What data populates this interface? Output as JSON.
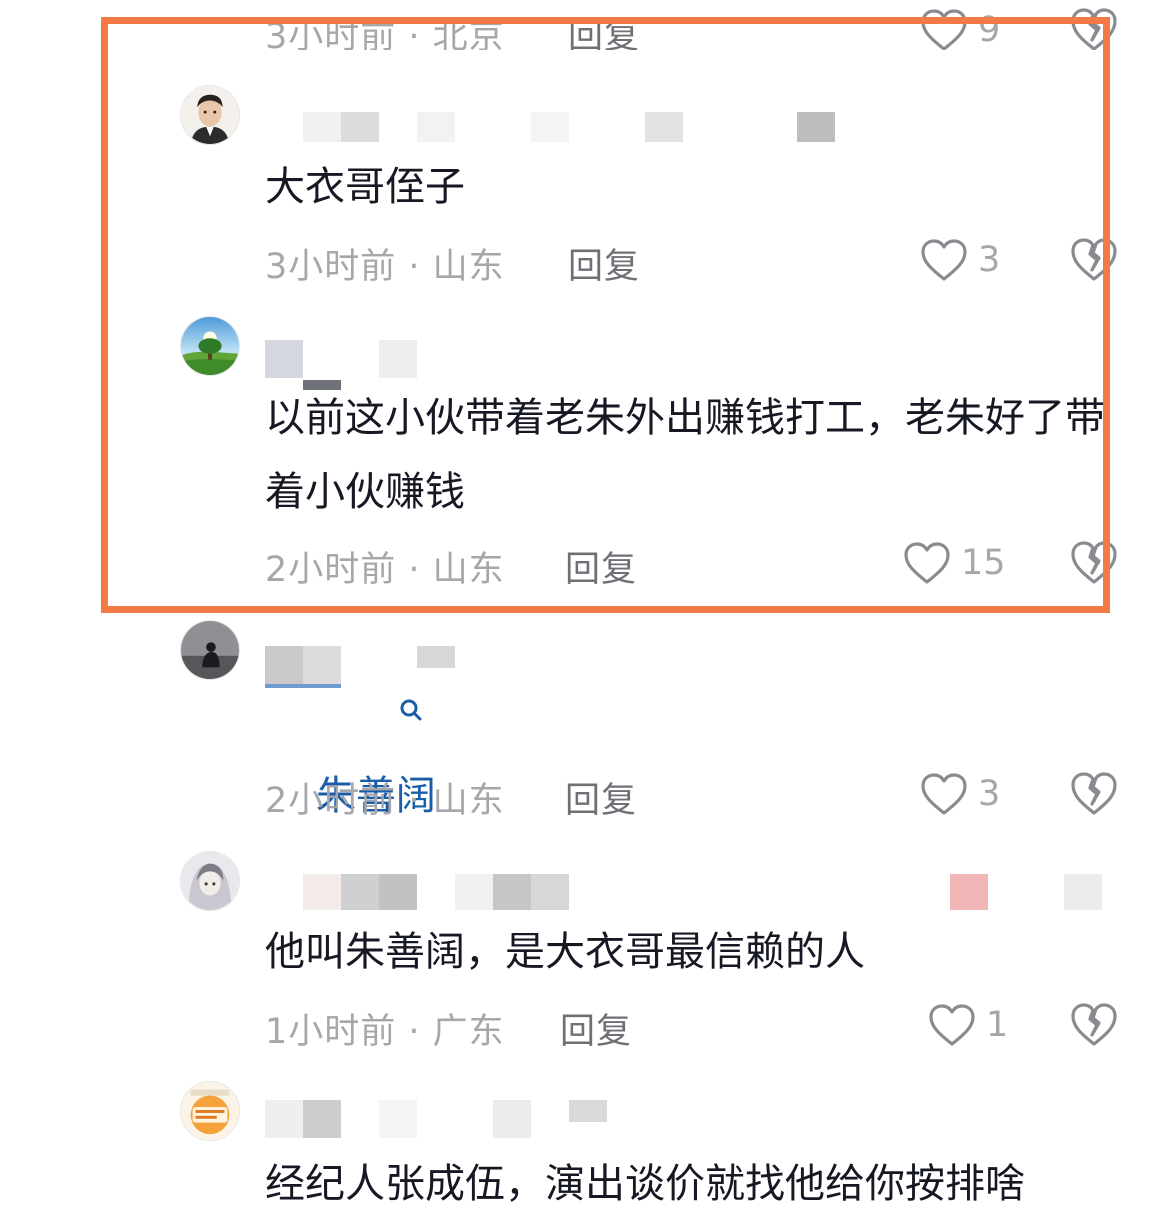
{
  "top_cutoff": {
    "meta": "3小时前 · 北京",
    "reply": "回复",
    "likes": "9"
  },
  "comments": [
    {
      "avatar": "boy-portrait-avatar",
      "text": "大衣哥侄子",
      "meta": "3小时前 · 山东",
      "reply": "回复",
      "likes": "3"
    },
    {
      "avatar": "tree-landscape-avatar",
      "text": "以前这小伙带着老朱外出赚钱打工，老朱好了带着小伙赚钱",
      "meta": "2小时前 · 山东",
      "reply": "回复",
      "likes": "15"
    },
    {
      "avatar": "dark-silhouette-avatar",
      "text": "朱善阔",
      "meta": "2小时前 · 山东",
      "reply": "回复",
      "likes": "3"
    },
    {
      "avatar": "anime-character-avatar",
      "text": "他叫朱善阔，是大衣哥最信赖的人",
      "meta": "1小时前 · 广东",
      "reply": "回复",
      "likes": "1"
    },
    {
      "avatar": "orange-badge-avatar",
      "text": "经纪人张成伍，演出谈价就找他给你按排啥",
      "meta": "",
      "reply": "",
      "likes": ""
    }
  ],
  "colors": {
    "highlight_border": "#f47a45",
    "link_text": "#1a5ea8",
    "meta_text": "#a6a7ab"
  }
}
